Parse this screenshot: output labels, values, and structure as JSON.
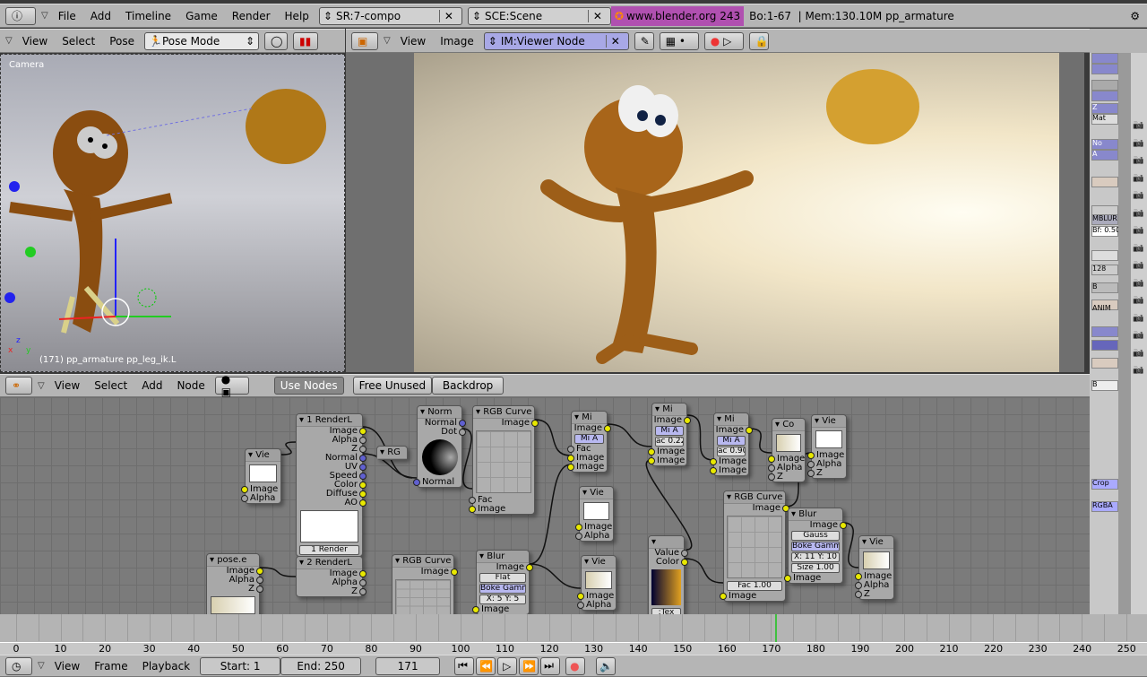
{
  "info_header": {
    "menus": [
      "File",
      "Add",
      "Timeline",
      "Game",
      "Render",
      "Help"
    ],
    "screen": "SR:7-compo",
    "scene": "SCE:Scene",
    "version": "www.blender.org 243",
    "stats": "Bo:1-67  | Mem:130.10M pp_armature"
  },
  "view3d": {
    "menus": [
      "View",
      "Select",
      "Pose"
    ],
    "mode": "Pose Mode",
    "label_camera": "Camera",
    "status": "(171) pp_armature pp_leg_ik.L",
    "axes": [
      "z",
      "x",
      "y"
    ]
  },
  "image_editor": {
    "menus": [
      "View",
      "Image"
    ],
    "image": "IM:Viewer Node"
  },
  "node_editor": {
    "menus": [
      "View",
      "Select",
      "Add",
      "Node"
    ],
    "buttons": [
      "Use Nodes",
      "Free Unused",
      "Backdrop"
    ],
    "nodes": [
      {
        "title": "Vie",
        "outs": [],
        "ins": [
          "Image",
          "Alpha"
        ],
        "thumb": true
      },
      {
        "title": "1 RenderL",
        "outs": [
          "Image",
          "Alpha",
          "Z",
          "Normal",
          "UV",
          "Speed",
          "Color",
          "Diffuse",
          "AO"
        ],
        "ins": [],
        "thumb": true,
        "ctrls": [
          "1 Render"
        ]
      },
      {
        "title": "RG",
        "outs": [],
        "ins": []
      },
      {
        "title": "Norm",
        "outs": [
          "Normal",
          "Dot"
        ],
        "ins": [
          "Normal"
        ],
        "sphere": true
      },
      {
        "title": "RGB Curve",
        "outs": [
          "Image"
        ],
        "ins": [
          "Fac",
          "Image"
        ],
        "curve": true
      },
      {
        "title": "Mi",
        "outs": [
          "Image"
        ],
        "ins": [
          "Fac",
          "Image",
          "Image"
        ],
        "ctrls": [
          "Mi  A"
        ]
      },
      {
        "title": "Vie",
        "outs": [],
        "ins": [
          "Image",
          "Alpha"
        ],
        "thumb": true
      },
      {
        "title": "Mi",
        "outs": [
          "Image"
        ],
        "ins": [
          "Image",
          "Image"
        ],
        "ctrls": [
          "Mi  A",
          "ac 0.22"
        ]
      },
      {
        "title": "Mi",
        "outs": [
          "Image"
        ],
        "ins": [
          "Image",
          "Image"
        ],
        "ctrls": [
          "Mi  A",
          "ac 0.90"
        ]
      },
      {
        "title": "Co",
        "outs": [],
        "ins": [
          "Image",
          "Alpha",
          "Z"
        ],
        "thumb": true
      },
      {
        "title": "Vie",
        "outs": [],
        "ins": [
          "Image",
          "Alpha",
          "Z"
        ],
        "thumb": true
      },
      {
        "title": "RGB Curve",
        "outs": [
          "Image"
        ],
        "ins": [
          "Image"
        ],
        "curve": true,
        "ctrls": [
          "Fac 1.00"
        ]
      },
      {
        "title": "Blur",
        "outs": [
          "Image"
        ],
        "ins": [
          "Image"
        ],
        "ctrls": [
          "Gauss",
          "Boke Gamm",
          "X: 11  Y: 10",
          "Size 1.00"
        ]
      },
      {
        "title": "Vie",
        "outs": [],
        "ins": [
          "Image",
          "Alpha",
          "Z"
        ],
        "thumb": true
      },
      {
        "title": "",
        "outs": [
          "Value",
          "Color"
        ],
        "ins": [],
        "band": true,
        "ctrls": [
          ":Tex"
        ]
      },
      {
        "title": "Vie",
        "outs": [],
        "ins": [
          "Image",
          "Alpha"
        ],
        "thumb": true
      },
      {
        "title": "Blur",
        "outs": [
          "Image"
        ],
        "ins": [
          "Image"
        ],
        "ctrls": [
          "Flat",
          "Boke Gamm",
          "X: 5  Y: 5"
        ]
      },
      {
        "title": "RGB Curve",
        "outs": [
          "Image"
        ],
        "ins": [],
        "curve": true
      },
      {
        "title": "2 RenderL",
        "outs": [
          "Image",
          "Alpha",
          "Z"
        ],
        "ins": []
      },
      {
        "title": "pose.e",
        "outs": [
          "Image",
          "Alpha",
          "Z"
        ],
        "ins": [],
        "thumb": true
      }
    ]
  },
  "buttons_window": {
    "labels": [
      "Z",
      "Mat",
      "No",
      "A",
      "MBLUR",
      "Bf: 0.50",
      "128",
      "B",
      "ANIM",
      "B",
      "Crop",
      "RGBA"
    ]
  },
  "timeline": {
    "ticks": [
      "0",
      "10",
      "20",
      "30",
      "40",
      "50",
      "60",
      "70",
      "80",
      "90",
      "100",
      "110",
      "120",
      "130",
      "140",
      "150",
      "160",
      "170",
      "180",
      "190",
      "200",
      "210",
      "220",
      "230",
      "240",
      "250"
    ],
    "current_frame": 171,
    "menus": [
      "View",
      "Frame",
      "Playback"
    ],
    "start": "Start: 1",
    "end": "End: 250",
    "frame_field": "171"
  },
  "colors": {
    "header": "#b5b5b5",
    "node_bg": "#7b7b7b",
    "current_frame": "#40c040",
    "socket_image": "#e8e800"
  }
}
